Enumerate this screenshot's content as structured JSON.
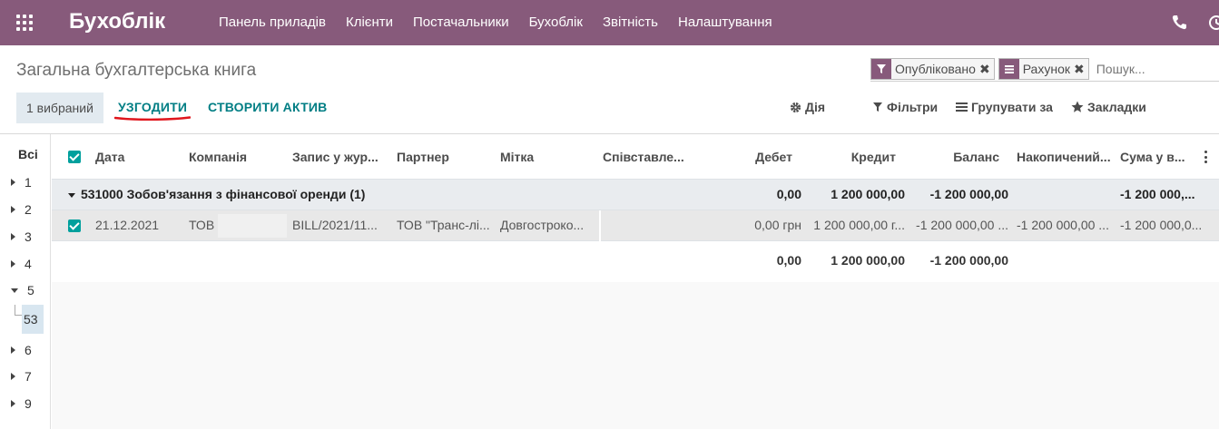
{
  "app": {
    "brand": "Бухоблік"
  },
  "menu": [
    "Панель приладів",
    "Клієнти",
    "Постачальники",
    "Бухоблік",
    "Звітність",
    "Налаштування"
  ],
  "breadcrumb": "Загальна бухгалтерська книга",
  "search": {
    "facets": [
      {
        "label": "Опубліковано",
        "icon": "filter-icon"
      },
      {
        "label": "Рахунок",
        "icon": "group-icon"
      }
    ],
    "placeholder": "Пошук..."
  },
  "actions": {
    "selected": "1 вибраний",
    "reconcile": "УЗГОДИТИ",
    "create_asset": "СТВОРИТИ АКТИВ"
  },
  "tools": {
    "action": "Дія",
    "filters": "Фільтри",
    "group_by": "Групувати за",
    "favorites": "Закладки"
  },
  "hierarchy": {
    "all": "Всі",
    "items": [
      "1",
      "2",
      "3",
      "4",
      "5",
      "6",
      "7",
      "9"
    ],
    "expanded": "5",
    "sub_item": "53"
  },
  "table": {
    "columns": [
      "Дата",
      "Компанія",
      "Запис у жур...",
      "Партнер",
      "Мітка",
      "Співставле...",
      "Дебет",
      "Кредит",
      "Баланс",
      "Накопичений...",
      "Сума у в..."
    ],
    "group": {
      "label": "531000 Зобов'язання з фінансової оренди (1)",
      "debit": "0,00",
      "credit": "1 200 000,00",
      "balance": "-1 200 000,00",
      "amount_currency": "-1 200 000,..."
    },
    "rows": [
      {
        "date": "21.12.2021",
        "company": "ТОВ",
        "journal_entry": "BILL/2021/11...",
        "partner": "ТОВ \"Транс-лі...",
        "label": "Довгостроко...",
        "matching": "",
        "debit": "0,00 грн",
        "credit": "1 200 000,00 г...",
        "balance": "-1 200 000,00 ...",
        "cumulated": "-1 200 000,00 ...",
        "amount_currency": "-1 200 000,0..."
      }
    ],
    "totals": {
      "debit": "0,00",
      "credit": "1 200 000,00",
      "balance": "-1 200 000,00"
    }
  },
  "colors": {
    "topbar": "#875a7b",
    "accent": "#017e84",
    "checkbox": "#00a09d",
    "annotation": "#e0161d"
  }
}
